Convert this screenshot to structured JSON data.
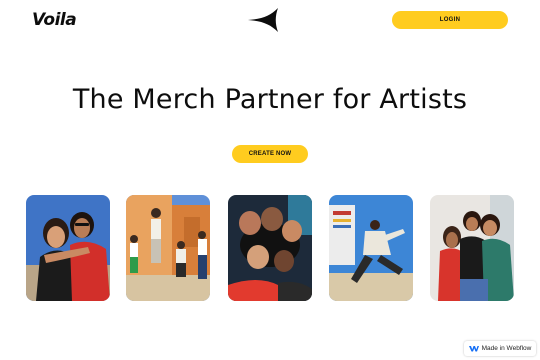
{
  "header": {
    "logo_text": "Voila",
    "login_label": "LOGIN",
    "emblem_icon": "four-point-star-icon"
  },
  "hero": {
    "title": "The Merch Partner for Artists",
    "cta_label": "CREATE NOW"
  },
  "gallery": {
    "photos": [
      {
        "subject": "two women embracing, blue sky"
      },
      {
        "subject": "group jumping against colorful wall"
      },
      {
        "subject": "group looking down at camera, dark background"
      },
      {
        "subject": "man posing in white jacket, blue sky"
      },
      {
        "subject": "friends hugging outdoors"
      }
    ]
  },
  "badge": {
    "label": "Made in Webflow",
    "icon": "webflow-icon"
  },
  "colors": {
    "accent": "#FFCC1F",
    "text": "#0d0d0d",
    "background": "#ffffff"
  }
}
